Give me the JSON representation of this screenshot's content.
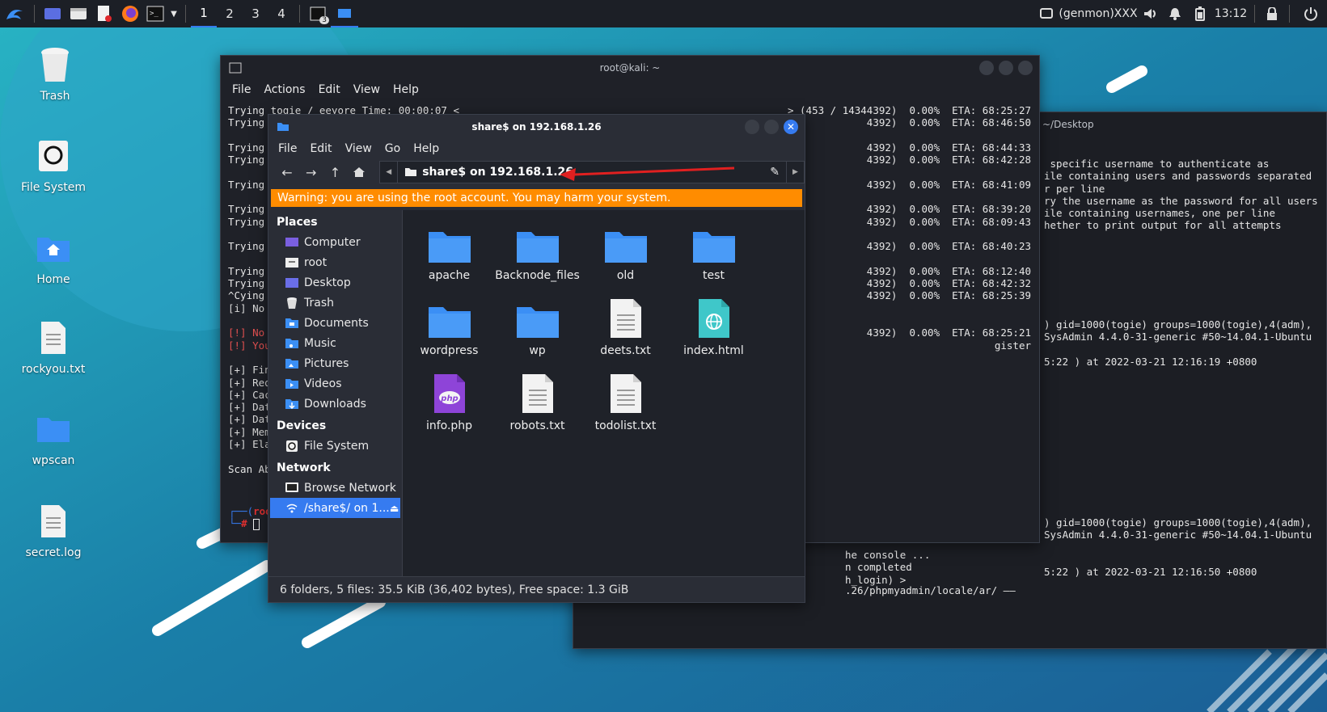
{
  "panel": {
    "workspaces": [
      "1",
      "2",
      "3",
      "4"
    ],
    "active_workspace": 0,
    "genmon": "(genmon)XXX",
    "clock": "13:12",
    "task_badge": "3"
  },
  "desktop_icons": [
    {
      "label": "Trash",
      "icon": "trash-icon"
    },
    {
      "label": "File System",
      "icon": "drive-icon"
    },
    {
      "label": "Home",
      "icon": "home-folder-icon"
    },
    {
      "label": "rockyou.txt",
      "icon": "text-file-icon"
    },
    {
      "label": "wpscan",
      "icon": "folder-icon"
    },
    {
      "label": "secret.log",
      "icon": "text-file-icon"
    }
  ],
  "terminal": {
    "title": "root@kali: ~",
    "menu": [
      "File",
      "Actions",
      "Edit",
      "View",
      "Help"
    ],
    "left_lines": [
      "Trying togie / eeyore Time: 00:00:07 <",
      "Trying t",
      "",
      "Trying t",
      "Trying t",
      "",
      "Trying t",
      "",
      "Trying t",
      "Trying t",
      "",
      "Trying t",
      "",
      "Trying t",
      "Trying t",
      "^Cying t",
      "[i] No V",
      "",
      "[!] No W",
      "[!] You ",
      "",
      "[+] Fini",
      "[+] Requ",
      "[+] Cach",
      "[+] Data",
      "[+] Data",
      "[+] Memo",
      "[+] Elap",
      "",
      "Scan Abo"
    ],
    "right_lines": [
      "> (453 / 14344392)  0.00%  ETA: 68:25:27",
      "4392)  0.00%  ETA: 68:46:50",
      "",
      "4392)  0.00%  ETA: 68:44:33",
      "4392)  0.00%  ETA: 68:42:28",
      "",
      "4392)  0.00%  ETA: 68:41:09",
      "",
      "4392)  0.00%  ETA: 68:39:20",
      "4392)  0.00%  ETA: 68:09:43",
      "",
      "4392)  0.00%  ETA: 68:40:23",
      "",
      "4392)  0.00%  ETA: 68:12:40",
      "4392)  0.00%  ETA: 68:42:32",
      "4392)  0.00%  ETA: 68:25:39",
      "",
      "",
      "4392)  0.00%  ETA: 68:25:21",
      "gister"
    ],
    "prompt_user": "root",
    "prompt_hash": "#"
  },
  "terminal2": {
    "title": "~/Desktop",
    "lines": [
      " specific username to authenticate as",
      "ile containing users and passwords separated",
      "r per line",
      "ry the username as the password for all users",
      "ile containing usernames, one per line",
      "hether to print output for all attempts",
      "",
      "",
      "",
      "",
      "",
      "",
      "",
      ") gid=1000(togie) groups=1000(togie),4(adm),",
      "SysAdmin 4.4.0-31-generic #50~14.04.1-Ubuntu",
      "",
      "5:22 ) at 2022-03-21 12:16:19 +0800",
      "",
      "",
      "",
      "",
      "",
      "",
      "",
      "",
      "",
      "",
      "",
      "",
      ") gid=1000(togie) groups=1000(togie),4(adm),",
      "SysAdmin 4.4.0-31-generic #50~14.04.1-Ubuntu",
      "",
      "",
      "5:22 ) at 2022-03-21 12:16:50 +0800"
    ],
    "bottom_lines": [
      "he console ...",
      "n completed",
      "h_login) > "
    ],
    "last_line": ".26/phpmyadmin/locale/ar/ ——"
  },
  "file_manager": {
    "title": "share$ on 192.168.1.26",
    "menu": [
      "File",
      "Edit",
      "View",
      "Go",
      "Help"
    ],
    "location": "share$ on 192.168.1.26",
    "warning": "Warning: you are using the root account. You may harm your system.",
    "sidebar": {
      "places_label": "Places",
      "places": [
        {
          "label": "Computer",
          "icon": "computer-icon"
        },
        {
          "label": "root",
          "icon": "home-icon"
        },
        {
          "label": "Desktop",
          "icon": "desktop-icon"
        },
        {
          "label": "Trash",
          "icon": "trash-icon"
        },
        {
          "label": "Documents",
          "icon": "documents-icon"
        },
        {
          "label": "Music",
          "icon": "music-icon"
        },
        {
          "label": "Pictures",
          "icon": "pictures-icon"
        },
        {
          "label": "Videos",
          "icon": "videos-icon"
        },
        {
          "label": "Downloads",
          "icon": "downloads-icon"
        }
      ],
      "devices_label": "Devices",
      "devices": [
        {
          "label": "File System",
          "icon": "drive-icon"
        }
      ],
      "network_label": "Network",
      "network": [
        {
          "label": "Browse Network",
          "icon": "network-icon"
        },
        {
          "label": "/share$/ on 1...",
          "icon": "network-share-icon"
        }
      ]
    },
    "files": [
      {
        "name": "apache",
        "type": "folder"
      },
      {
        "name": "Backnode_files",
        "type": "folder"
      },
      {
        "name": "old",
        "type": "folder"
      },
      {
        "name": "test",
        "type": "folder"
      },
      {
        "name": "wordpress",
        "type": "folder"
      },
      {
        "name": "wp",
        "type": "folder"
      },
      {
        "name": "deets.txt",
        "type": "text"
      },
      {
        "name": "index.html",
        "type": "html"
      },
      {
        "name": "info.php",
        "type": "php"
      },
      {
        "name": "robots.txt",
        "type": "text"
      },
      {
        "name": "todolist.txt",
        "type": "text"
      }
    ],
    "php_badge": "php",
    "status": "6 folders, 5 files: 35.5 KiB (36,402 bytes), Free space: 1.3 GiB"
  },
  "colors": {
    "accent": "#367bf0",
    "warning": "#ff8c00",
    "folder": "#3b8ff5",
    "annotation_arrow": "#e02020"
  }
}
